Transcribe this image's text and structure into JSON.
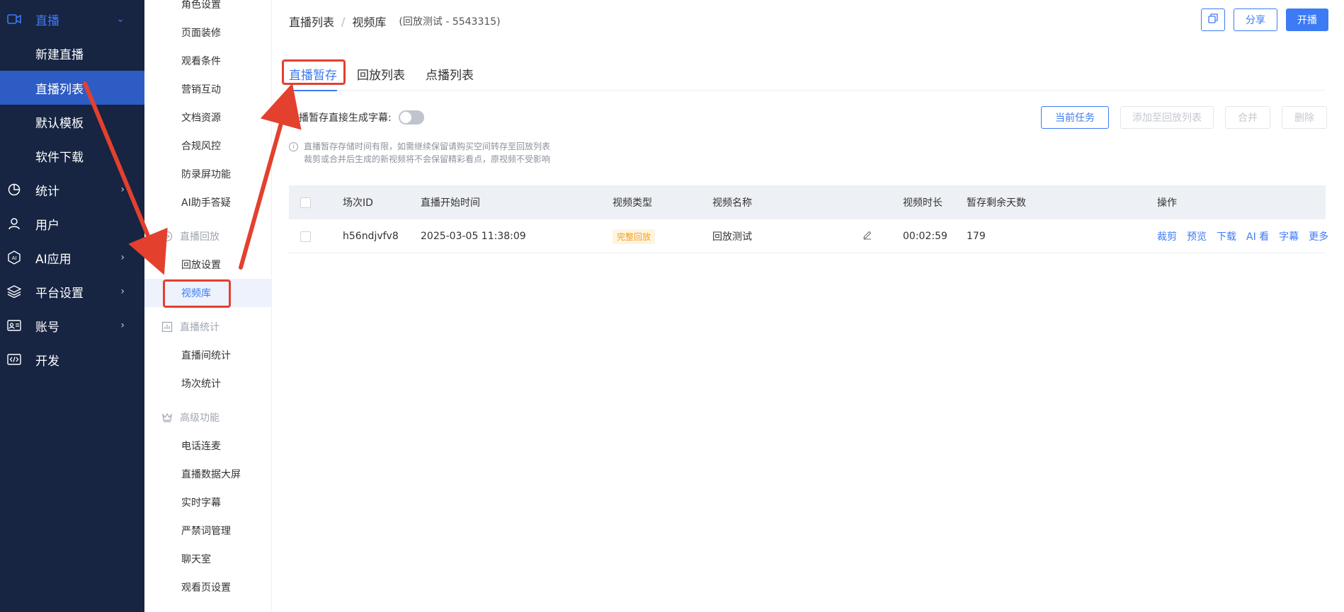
{
  "sidebar": {
    "items": [
      {
        "label": "直播",
        "icon": "video-camera-icon",
        "arrow": "⌄"
      },
      {
        "label": "新建直播"
      },
      {
        "label": "直播列表"
      },
      {
        "label": "默认模板"
      },
      {
        "label": "软件下载"
      },
      {
        "label": "统计",
        "icon": "pie-chart-icon",
        "arrow": "›"
      },
      {
        "label": "用户",
        "icon": "user-icon"
      },
      {
        "label": "AI应用",
        "icon": "ai-hexagon-icon",
        "arrow": "›"
      },
      {
        "label": "平台设置",
        "icon": "layers-icon",
        "arrow": "›"
      },
      {
        "label": "账号",
        "icon": "id-card-icon",
        "arrow": "›"
      },
      {
        "label": "开发",
        "icon": "code-icon"
      }
    ]
  },
  "subnav": {
    "items": [
      {
        "label": "角色设置"
      },
      {
        "label": "页面装修"
      },
      {
        "label": "观看条件"
      },
      {
        "label": "营销互动"
      },
      {
        "label": "文档资源"
      },
      {
        "label": "合规风控"
      },
      {
        "label": "防录屏功能"
      },
      {
        "label": "AI助手答疑"
      },
      {
        "label": "直播回放",
        "group": true,
        "icon": "play-circle-icon"
      },
      {
        "label": "回放设置"
      },
      {
        "label": "视频库"
      },
      {
        "label": "直播统计",
        "group": true,
        "icon": "bar-chart-icon"
      },
      {
        "label": "直播间统计"
      },
      {
        "label": "场次统计"
      },
      {
        "label": "高级功能",
        "group": true,
        "icon": "crown-icon"
      },
      {
        "label": "电话连麦"
      },
      {
        "label": "直播数据大屏"
      },
      {
        "label": "实时字幕"
      },
      {
        "label": "严禁词管理"
      },
      {
        "label": "聊天室"
      },
      {
        "label": "观看页设置"
      }
    ]
  },
  "header": {
    "breadcrumb_root": "直播列表",
    "breadcrumb_sep": "/",
    "breadcrumb_current": "视频库",
    "breadcrumb_sub": "(回放测试 - 5543315)",
    "share_label": "分享",
    "start_label": "开播"
  },
  "tabs": [
    {
      "label": "直播暂存"
    },
    {
      "label": "回放列表"
    },
    {
      "label": "点播列表"
    }
  ],
  "toolbar": {
    "switch_label": "直播暂存直接生成字幕:",
    "current_task": "当前任务",
    "add_to_replay": "添加至回放列表",
    "merge": "合并",
    "delete": "删除"
  },
  "notice": {
    "line1": "直播暂存存储时间有限，如需继续保留请购买空间转存至回放列表",
    "line2": "裁剪或合并后生成的新视频将不会保留精彩看点，原视频不受影响"
  },
  "table": {
    "headers": [
      "场次ID",
      "直播开始时间",
      "视频类型",
      "视频名称",
      "视频时长",
      "暂存剩余天数",
      "操作"
    ],
    "rows": [
      {
        "id": "h56ndjvfv8",
        "start": "2025-03-05 11:38:09",
        "type": "完整回放",
        "name": "回放测试",
        "duration": "00:02:59",
        "days": "179",
        "ops": [
          "裁剪",
          "预览",
          "下载",
          "AI 看",
          "字幕",
          "更多"
        ]
      }
    ]
  },
  "colors": {
    "sidebar_bg": "#172442",
    "accent": "#3d7bf5",
    "annotation": "#e3402e"
  }
}
